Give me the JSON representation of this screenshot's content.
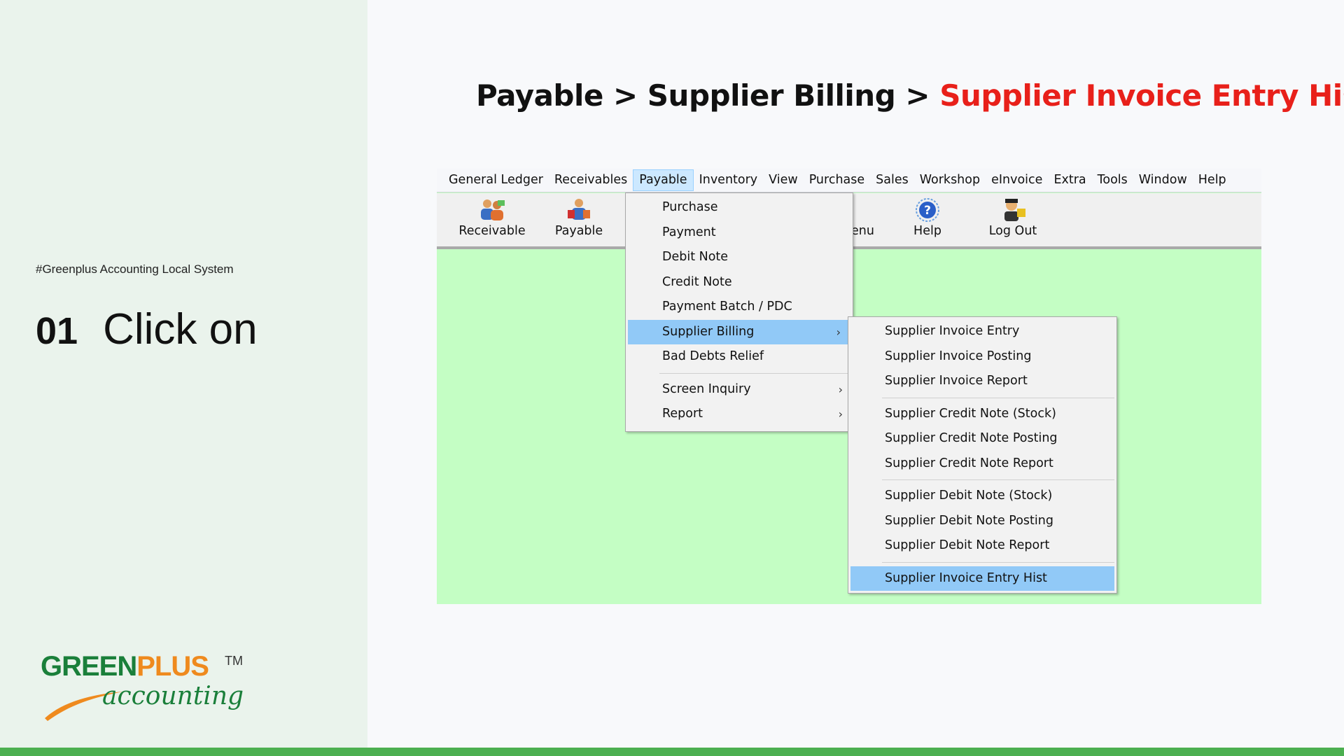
{
  "sidebar": {
    "hashtag": "#Greenplus Accounting Local System",
    "step_number": "01",
    "step_text": "Click on",
    "logo": {
      "part1": "GREEN",
      "part2": "PLUS",
      "tm": "TM",
      "subtitle": "accounting"
    }
  },
  "title": {
    "prefix": "Payable > Supplier Billing > ",
    "highlight": "Supplier Invoice Entry Hist"
  },
  "app": {
    "menubar": [
      "General Ledger",
      "Receivables",
      "Payable",
      "Inventory",
      "View",
      "Purchase",
      "Sales",
      "Workshop",
      "eInvoice",
      "Extra",
      "Tools",
      "Window",
      "Help"
    ],
    "active_menu": "Payable",
    "toolbar": {
      "receivable": "Receivable",
      "payable": "Payable",
      "partial_label": "enu",
      "help": "Help",
      "logout": "Log Out"
    },
    "payable_menu": {
      "items": [
        "Purchase",
        "Payment",
        "Debit Note",
        "Credit Note",
        "Payment Batch / PDC",
        "Supplier Billing",
        "Bad Debts Relief"
      ],
      "items2": [
        "Screen Inquiry",
        "Report"
      ],
      "arrow": "›"
    },
    "billing_menu": {
      "group1": [
        "Supplier Invoice Entry",
        "Supplier Invoice Posting",
        "Supplier Invoice Report"
      ],
      "group2": [
        "Supplier Credit Note (Stock)",
        "Supplier Credit Note Posting",
        "Supplier Credit Note Report"
      ],
      "group3": [
        "Supplier Debit Note (Stock)",
        "Supplier Debit Note Posting",
        "Supplier Debit Note Report"
      ],
      "group4": [
        "Supplier Invoice Entry Hist"
      ]
    }
  },
  "colors": {
    "accent_green": "#1a7f3a",
    "accent_orange": "#ef8a1e",
    "highlight_red": "#e8201a",
    "workspace_green": "#c4fec4",
    "selection_blue": "#91c9f7"
  }
}
